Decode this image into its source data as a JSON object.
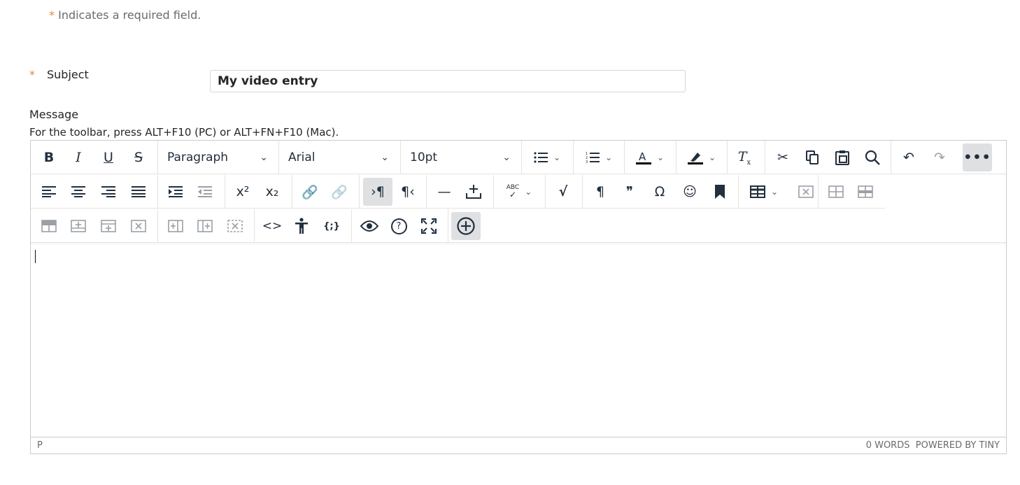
{
  "form": {
    "required_note_star": "*",
    "required_note": "Indicates a required field.",
    "subject_star": "*",
    "subject_label": "Subject",
    "subject_value": "My video entry",
    "message_label": "Message",
    "toolbar_hint": "For the toolbar, press ALT+F10 (PC) or ALT+FN+F10 (Mac)."
  },
  "toolbar": {
    "block_format": "Paragraph",
    "font_family": "Arial",
    "font_size": "10pt",
    "row1_icons": [
      "bold-icon",
      "italic-icon",
      "underline-icon",
      "strikethrough-icon",
      "bullet-list-icon",
      "numbered-list-icon",
      "text-color-icon",
      "highlight-icon",
      "clear-formatting-icon",
      "cut-icon",
      "copy-icon",
      "paste-icon",
      "search-icon",
      "undo-icon",
      "redo-icon",
      "more-icon"
    ],
    "row2_icons": [
      "align-left-icon",
      "align-center-icon",
      "align-right-icon",
      "justify-icon",
      "indent-icon",
      "outdent-icon",
      "superscript-icon",
      "subscript-icon",
      "link-icon",
      "unlink-icon",
      "ltr-icon",
      "rtl-icon",
      "horizontal-line-icon",
      "insert-icon",
      "spellcheck-icon",
      "math-icon",
      "paragraph-mark-icon",
      "blockquote-icon",
      "omega-icon",
      "emoji-icon",
      "bookmark-icon",
      "table-icon",
      "delete-table-icon",
      "table-cell-icon",
      "table-row-icon"
    ],
    "row3_icons": [
      "table-header-icon",
      "insert-row-before-icon",
      "insert-row-after-icon",
      "delete-row-icon",
      "insert-col-before-icon",
      "insert-col-after-icon",
      "delete-col-icon",
      "code-icon",
      "accessibility-icon",
      "variables-icon",
      "preview-icon",
      "help-icon",
      "fullscreen-icon",
      "add-content-icon"
    ],
    "superscript_label": "x²",
    "subscript_label": "x₂",
    "bold_label": "B",
    "italic_label": "I",
    "underline_label": "U",
    "strike_label": "S",
    "paragraph_mark": "¶",
    "omega_label": "Ω",
    "quote_label": "❞",
    "code_label": "<>",
    "variables_label": "{;}",
    "help_label": "?",
    "spell_label": "ABC"
  },
  "statusbar": {
    "path": "P",
    "words": "0 WORDS",
    "powered": "POWERED BY TINY"
  }
}
